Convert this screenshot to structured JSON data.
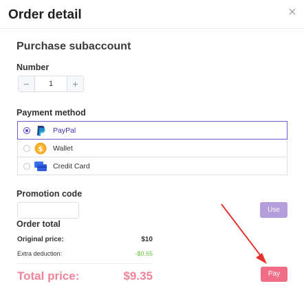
{
  "dialog": {
    "title": "Order detail",
    "section_title": "Purchase subaccount"
  },
  "number": {
    "label": "Number",
    "minus": "−",
    "value": "1",
    "plus": "+"
  },
  "payment": {
    "label": "Payment method",
    "options": [
      {
        "label": "PayPal",
        "icon": "paypal-icon",
        "selected": true
      },
      {
        "label": "Wallet",
        "icon": "wallet-coin-icon",
        "selected": false
      },
      {
        "label": "Credit Card",
        "icon": "credit-card-icon",
        "selected": false
      }
    ]
  },
  "promotion": {
    "label": "Promotion code",
    "value": "",
    "use_label": "Use"
  },
  "order_total": {
    "label": "Order total",
    "original_label": "Original price:",
    "original_value": "$10",
    "deduction_label": "Extra deduction:",
    "deduction_value": "-$0.65",
    "total_label": "Total price:",
    "total_value": "$9.35"
  },
  "pay_button": {
    "label": "Pay"
  },
  "colors": {
    "accent": "#5b3fd6",
    "use_button": "#b39ddb",
    "pay_button": "#f16d85",
    "total_text": "#f0839a",
    "deduction_text": "#67c23a",
    "annotation_arrow": "#e8322e"
  }
}
